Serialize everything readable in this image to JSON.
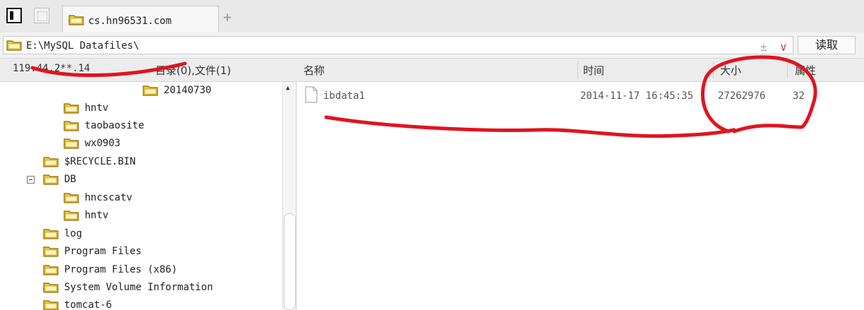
{
  "tabbar": {
    "active_tab_label": "cs.hn96531.com",
    "new_tab_symbol": "+"
  },
  "address_bar": {
    "path": "E:\\MySQL Datafiles\\",
    "plusminus_symbol": "±",
    "dropdown_symbol": "∨",
    "read_button_label": "读取"
  },
  "status": {
    "host": "119.44.2**.14",
    "summary": "目录(0),文件(1)"
  },
  "columns": {
    "name": "名称",
    "time": "时间",
    "size": "大小",
    "attr": "属性"
  },
  "tree": [
    {
      "label": "20140730"
    },
    {
      "label": "hntv"
    },
    {
      "label": "taobaosite"
    },
    {
      "label": "wx0903"
    },
    {
      "label": "$RECYCLE.BIN"
    },
    {
      "label": "DB",
      "expanded": true
    },
    {
      "label": "hncscatv"
    },
    {
      "label": "hntv"
    },
    {
      "label": "log"
    },
    {
      "label": "Program Files"
    },
    {
      "label": "Program Files (x86)"
    },
    {
      "label": "System Volume Information"
    },
    {
      "label": "tomcat-6"
    }
  ],
  "files": [
    {
      "name": "ibdata1",
      "time": "2014-11-17 16:45:35",
      "size": "27262976",
      "attr": "32"
    }
  ],
  "colors": {
    "folder_fill": "#f4c430",
    "folder_stroke": "#8a6a00",
    "annotation_red": "#e0141e"
  },
  "icons": [
    "window-icon",
    "tab-grid-icon",
    "folder-icon",
    "file-icon",
    "expander-minus-icon",
    "scroll-up-icon"
  ]
}
